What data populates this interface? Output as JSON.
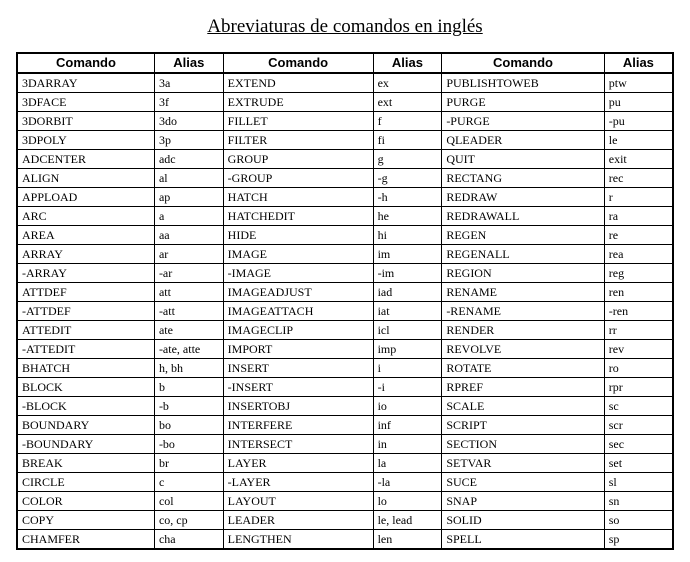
{
  "title": "Abreviaturas de comandos en inglés",
  "headers": {
    "comando": "Comando",
    "alias": "Alias"
  },
  "rows": [
    [
      "3DARRAY",
      "3a",
      "EXTEND",
      "ex",
      "PUBLISHTOWEB",
      "ptw"
    ],
    [
      "3DFACE",
      "3f",
      "EXTRUDE",
      "ext",
      "PURGE",
      "pu"
    ],
    [
      "3DORBIT",
      "3do",
      "FILLET",
      "f",
      "-PURGE",
      "-pu"
    ],
    [
      "3DPOLY",
      "3p",
      "FILTER",
      "fi",
      "QLEADER",
      "le"
    ],
    [
      "ADCENTER",
      "adc",
      "GROUP",
      "g",
      "QUIT",
      "exit"
    ],
    [
      "ALIGN",
      "al",
      "-GROUP",
      "-g",
      "RECTANG",
      "rec"
    ],
    [
      "APPLOAD",
      "ap",
      "HATCH",
      "-h",
      "REDRAW",
      "r"
    ],
    [
      "ARC",
      "a",
      "HATCHEDIT",
      "he",
      "REDRAWALL",
      "ra"
    ],
    [
      "AREA",
      "aa",
      "HIDE",
      "hi",
      "REGEN",
      "re"
    ],
    [
      "ARRAY",
      "ar",
      "IMAGE",
      "im",
      "REGENALL",
      "rea"
    ],
    [
      "-ARRAY",
      "-ar",
      "-IMAGE",
      "-im",
      "REGION",
      "reg"
    ],
    [
      "ATTDEF",
      "att",
      "IMAGEADJUST",
      "iad",
      "RENAME",
      "ren"
    ],
    [
      "-ATTDEF",
      "-att",
      "IMAGEATTACH",
      "iat",
      "-RENAME",
      "-ren"
    ],
    [
      "ATTEDIT",
      "ate",
      "IMAGECLIP",
      "icl",
      "RENDER",
      "rr"
    ],
    [
      "-ATTEDIT",
      "-ate, atte",
      "IMPORT",
      "imp",
      "REVOLVE",
      "rev"
    ],
    [
      "BHATCH",
      "h, bh",
      "INSERT",
      "i",
      "ROTATE",
      "ro"
    ],
    [
      "BLOCK",
      "b",
      "-INSERT",
      "-i",
      "RPREF",
      "rpr"
    ],
    [
      "-BLOCK",
      "-b",
      "INSERTOBJ",
      "io",
      "SCALE",
      "sc"
    ],
    [
      "BOUNDARY",
      "bo",
      "INTERFERE",
      "inf",
      "SCRIPT",
      "scr"
    ],
    [
      "-BOUNDARY",
      "-bo",
      "INTERSECT",
      "in",
      "SECTION",
      "sec"
    ],
    [
      "BREAK",
      "br",
      "LAYER",
      "la",
      "SETVAR",
      "set"
    ],
    [
      "CIRCLE",
      "c",
      "-LAYER",
      "-la",
      "SUCE",
      "sl"
    ],
    [
      "COLOR",
      "col",
      "LAYOUT",
      "lo",
      "SNAP",
      "sn"
    ],
    [
      "COPY",
      "co, cp",
      "LEADER",
      "le, lead",
      "SOLID",
      "so"
    ],
    [
      "CHAMFER",
      "cha",
      "LENGTHEN",
      "len",
      "SPELL",
      "sp"
    ]
  ]
}
